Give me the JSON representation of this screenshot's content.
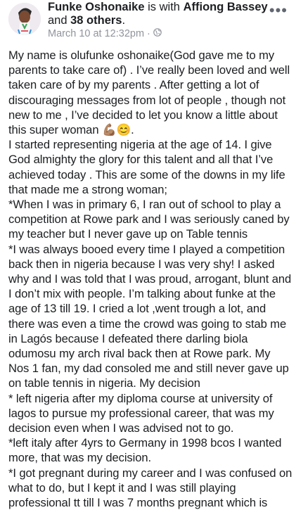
{
  "header": {
    "author": "Funke Oshonaike",
    "is_with": "is with",
    "tagged": "Affiong Bassey",
    "and_word": "and",
    "others": "38 others",
    "end_punct": ".",
    "timestamp": "March 10 at 12:32pm",
    "separator": "·",
    "privacy_icon": "globe-icon",
    "more_icon": "more-options-icon",
    "more_glyph": "•••"
  },
  "post": {
    "lines": [
      "My name is olufunke oshonaike(God gave me to my parents to take care of) . I’ve really been loved and well taken care of by my parents . After getting a lot of discouraging messages from lot of people , though not new to me , I’ve decided to let you know a little about this super woman 💪🏽😊.",
      "I started representing nigeria at the age of 14. I give God almighty the glory for this talent and all that I’ve achieved today . This are some of the downs in my life that made me a strong woman;",
      "*When I was in primary 6, I ran out of school to play a competition at Rowe park and I was seriously caned by my teacher but I never gave up on Table tennis",
      "*I was always booed every time I played a competition back then in nigeria because I was very shy! I asked why and I was told that I was proud, arrogant, blunt and I don’t mix with people. I’m talking about funke at the age of 13 till 19. I cried a lot ,went trough a lot, and there was even a time the crowd was going to stab me in Lagós because I defeated there darling biola odumosu my arch rival back then at Rowe park. My Nos 1 fan, my dad consoled me and still never gave up on table tennis in nigeria. My decision",
      "* left nigeria after my diploma course at university of lagos to pursue my professional career, that was my decision even when I was advised not to go.",
      "*left italy after 4yrs to Germany in 1998 bcos I wanted more, that was my decision.",
      "*I got pregnant during my career and I was confused on what to do, but I kept it and I was still playing professional tt till I was 7 months pregnant which is"
    ]
  }
}
